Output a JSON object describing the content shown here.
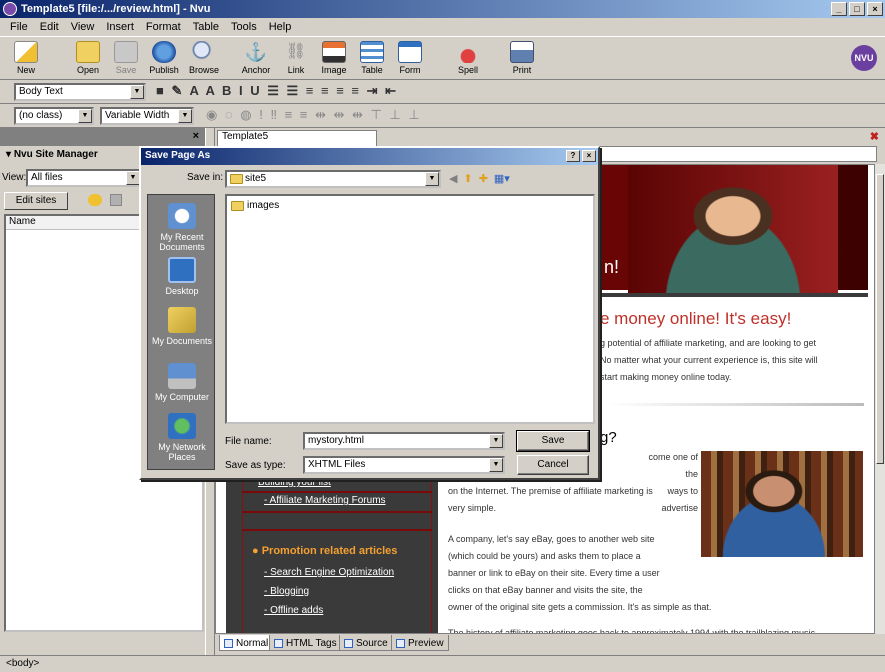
{
  "window": {
    "title": "Template5 [file:/.../review.html] - Nvu",
    "controls": [
      "_",
      "□",
      "×"
    ]
  },
  "menubar": [
    "File",
    "Edit",
    "View",
    "Insert",
    "Format",
    "Table",
    "Tools",
    "Help"
  ],
  "toolbar": {
    "items": [
      {
        "label": "New",
        "icon": "new-icon"
      },
      {
        "label": "Open",
        "icon": "open-icon"
      },
      {
        "label": "Save",
        "icon": "save-icon",
        "disabled": true
      },
      {
        "label": "Publish",
        "icon": "publish-icon"
      },
      {
        "label": "Browse",
        "icon": "browse-icon"
      },
      {
        "label": "Anchor",
        "icon": "anchor-icon"
      },
      {
        "label": "Link",
        "icon": "link-icon"
      },
      {
        "label": "Image",
        "icon": "image-icon"
      },
      {
        "label": "Table",
        "icon": "table-icon"
      },
      {
        "label": "Form",
        "icon": "form-icon"
      },
      {
        "label": "Spell",
        "icon": "spell-icon"
      },
      {
        "label": "Print",
        "icon": "print-icon"
      }
    ],
    "logo": "NVU"
  },
  "format": {
    "paragraph_style": "Body Text",
    "class": "(no class)",
    "font": "Variable Width"
  },
  "site_manager": {
    "title": "Nvu Site Manager",
    "view_label": "View:",
    "view_value": "All files",
    "edit_sites": "Edit sites",
    "column_name": "Name"
  },
  "editor": {
    "tab": "Template5",
    "banner_text": "n!",
    "headline": "e money online! It's easy!",
    "para1": [
      "g potential of affiliate marketing, and are looking to get",
      "No matter what your current experience is, this site will",
      "start making money online today."
    ],
    "question": "g?",
    "para2": [
      "come one of the",
      "ways to advertise",
      "on the Internet. The premise of affiliate marketing is",
      "very simple."
    ],
    "para3": [
      "A company, let's say eBay, goes to another web site",
      "(which could be yours) and asks them to place a",
      "banner or link to eBay on their site. Every time a user",
      "clicks on that eBay banner and visits the site, the",
      "owner of the original site gets a commission. It's as simple as that."
    ],
    "para4": "The history of affiliate marketing goes back to approximately 1994 with the trailblazing music",
    "nav": {
      "partial_link": "Building your list",
      "forums": "- Affiliate Marketing Forums",
      "promo_head": "Promotion related articles",
      "seo": "- Search Engine Optimization",
      "blogging": "- Blogging",
      "offline": "- Offline adds"
    }
  },
  "bottom_tabs": [
    "Normal",
    "HTML Tags",
    "Source",
    "Preview"
  ],
  "status": "<body>",
  "dialog": {
    "title": "Save Page As",
    "save_in_label": "Save in:",
    "save_in_value": "site5",
    "places": [
      "My Recent Documents",
      "Desktop",
      "My Documents",
      "My Computer",
      "My Network Places"
    ],
    "files": [
      "images"
    ],
    "file_name_label": "File name:",
    "file_name_value": "mystory.html",
    "save_type_label": "Save as type:",
    "save_type_value": "XHTML Files",
    "save_button": "Save",
    "cancel_button": "Cancel",
    "title_buttons": [
      "?",
      "×"
    ]
  }
}
